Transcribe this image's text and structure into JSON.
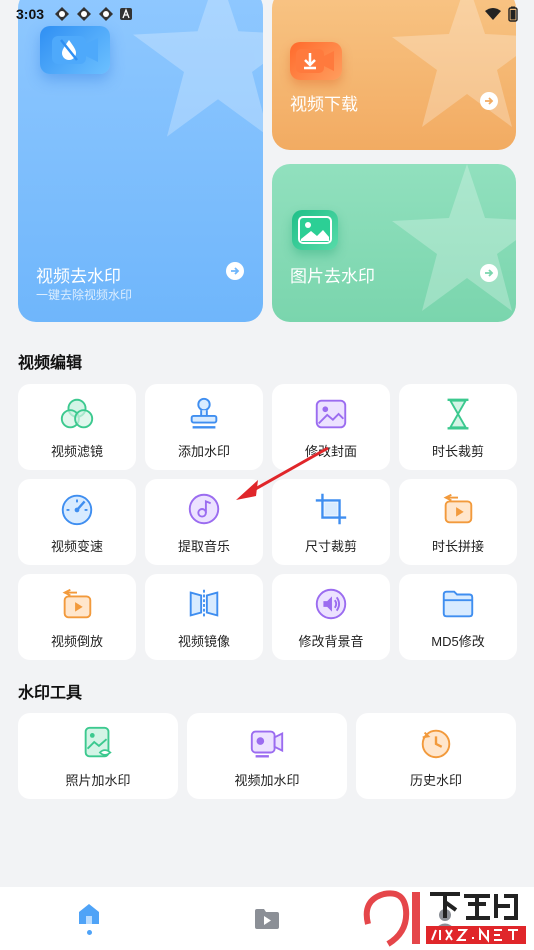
{
  "status_bar": {
    "time": "3:03"
  },
  "cards": {
    "video_remove": {
      "title": "视频去水印",
      "subtitle": "一键去除视频水印"
    },
    "video_download": {
      "title": "视频下载"
    },
    "image_remove": {
      "title": "图片去水印"
    }
  },
  "sections": {
    "video_edit": {
      "title": "视频编辑",
      "items": [
        {
          "label": "视频滤镜",
          "icon": "filter-circles-icon"
        },
        {
          "label": "添加水印",
          "icon": "stamp-icon"
        },
        {
          "label": "修改封面",
          "icon": "picture-icon"
        },
        {
          "label": "时长裁剪",
          "icon": "hourglass-icon"
        },
        {
          "label": "视频变速",
          "icon": "speedometer-icon"
        },
        {
          "label": "提取音乐",
          "icon": "music-disc-icon"
        },
        {
          "label": "尺寸裁剪",
          "icon": "crop-icon"
        },
        {
          "label": "时长拼接",
          "icon": "splice-icon"
        },
        {
          "label": "视频倒放",
          "icon": "reverse-play-icon"
        },
        {
          "label": "视频镜像",
          "icon": "mirror-icon"
        },
        {
          "label": "修改背景音",
          "icon": "speaker-icon"
        },
        {
          "label": "MD5修改",
          "icon": "folder-icon"
        }
      ]
    },
    "watermark_tools": {
      "title": "水印工具",
      "items": [
        {
          "label": "照片加水印",
          "icon": "photo-watermark-icon"
        },
        {
          "label": "视频加水印",
          "icon": "video-watermark-icon"
        },
        {
          "label": "历史水印",
          "icon": "history-icon"
        }
      ]
    }
  },
  "bottom_nav": [
    {
      "name": "home",
      "icon": "home-icon",
      "active": true
    },
    {
      "name": "video",
      "icon": "play-folder-icon",
      "active": false
    },
    {
      "name": "profile",
      "icon": "profile-icon",
      "active": false
    }
  ],
  "watermark": {
    "brand": "91下载站",
    "site": "91xz.net"
  },
  "colors": {
    "accent": "#4fa3f7",
    "annotation_arrow": "#e0262a"
  }
}
